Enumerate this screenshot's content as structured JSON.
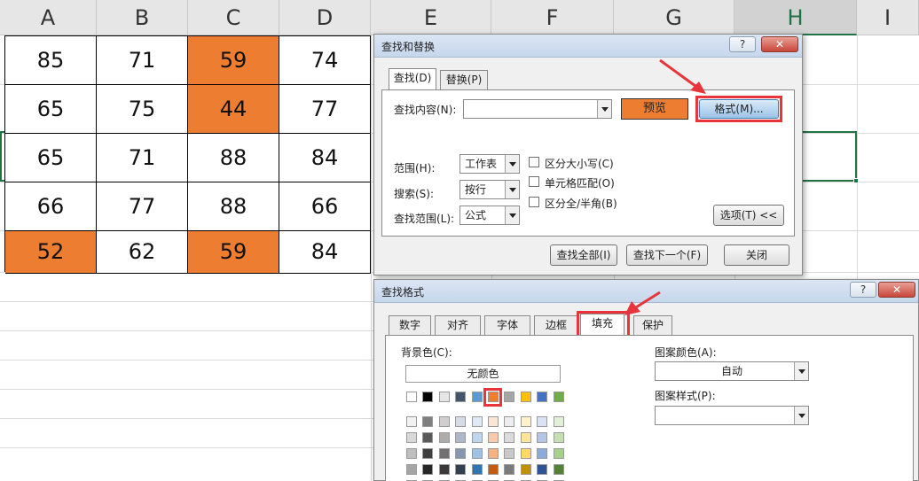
{
  "columns": [
    "A",
    "B",
    "C",
    "D",
    "E",
    "F",
    "G",
    "H",
    "I"
  ],
  "active_column": "H",
  "table": {
    "rows": [
      [
        85,
        71,
        59,
        74
      ],
      [
        65,
        75,
        44,
        77
      ],
      [
        65,
        71,
        88,
        84
      ],
      [
        66,
        77,
        88,
        66
      ],
      [
        52,
        62,
        59,
        84
      ]
    ],
    "highlighted": [
      [
        0,
        2
      ],
      [
        1,
        2
      ],
      [
        4,
        0
      ],
      [
        4,
        2
      ]
    ],
    "highlight_color": "#ed7d31"
  },
  "find_replace": {
    "title": "查找和替换",
    "help_label": "?",
    "close_label": "✕",
    "tabs": [
      "查找(D)",
      "替换(P)"
    ],
    "find_what_label": "查找内容(N):",
    "find_what_value": "",
    "preview_label": "预览",
    "format_button": "格式(M)...",
    "scope_label": "范围(H):",
    "scope_value": "工作表",
    "search_label": "搜索(S):",
    "search_value": "按行",
    "look_in_label": "查找范围(L):",
    "look_in_value": "公式",
    "match_case": "区分大小写(C)",
    "match_cell": "单元格匹配(O)",
    "match_width": "区分全/半角(B)",
    "options_button": "选项(T) <<",
    "find_all_button": "查找全部(I)",
    "find_next_button": "查找下一个(F)",
    "close_button": "关闭"
  },
  "find_format": {
    "title": "查找格式",
    "help_label": "?",
    "close_label": "✕",
    "tabs": [
      "数字",
      "对齐",
      "字体",
      "边框",
      "填充",
      "保护"
    ],
    "active_tab": "填充",
    "bg_color_label": "背景色(C):",
    "no_color_button": "无颜色",
    "pattern_color_label": "图案颜色(A):",
    "pattern_color_value": "自动",
    "pattern_style_label": "图案样式(P):",
    "pattern_style_value": "",
    "theme_colors_row1": [
      "#ffffff",
      "#000000",
      "#e7e6e6",
      "#44546a",
      "#5b9bd5",
      "#ed7d31",
      "#a5a5a5",
      "#ffc000",
      "#4472c4",
      "#70ad47"
    ],
    "selected_swatch_color": "#ed7d31",
    "shade_rows": [
      [
        "#f2f2f2",
        "#7f7f7f",
        "#d0cece",
        "#d6dce4",
        "#deebf6",
        "#fbe5d5",
        "#ededed",
        "#fff2cc",
        "#dae3f3",
        "#e2efd9"
      ],
      [
        "#d8d8d8",
        "#595959",
        "#aeabab",
        "#adb9ca",
        "#bdd7ee",
        "#f8cbad",
        "#dbdbdb",
        "#fee599",
        "#b4c6e7",
        "#c5e0b3"
      ],
      [
        "#bfbfbf",
        "#3f3f3f",
        "#757070",
        "#8496b0",
        "#9cc3e5",
        "#f4b183",
        "#c9c9c9",
        "#ffd965",
        "#8eaadb",
        "#a8d08d"
      ],
      [
        "#a5a5a5",
        "#262626",
        "#3a3838",
        "#323f4f",
        "#2e75b5",
        "#c55a11",
        "#7b7b7b",
        "#bf9000",
        "#2f5496",
        "#538135"
      ],
      [
        "#7f7f7f",
        "#0c0c0c",
        "#171616",
        "#222a35",
        "#1e4e79",
        "#833c0b",
        "#525252",
        "#7f6000",
        "#1f3864",
        "#375623"
      ]
    ]
  },
  "annotation_color": "#e8353b"
}
